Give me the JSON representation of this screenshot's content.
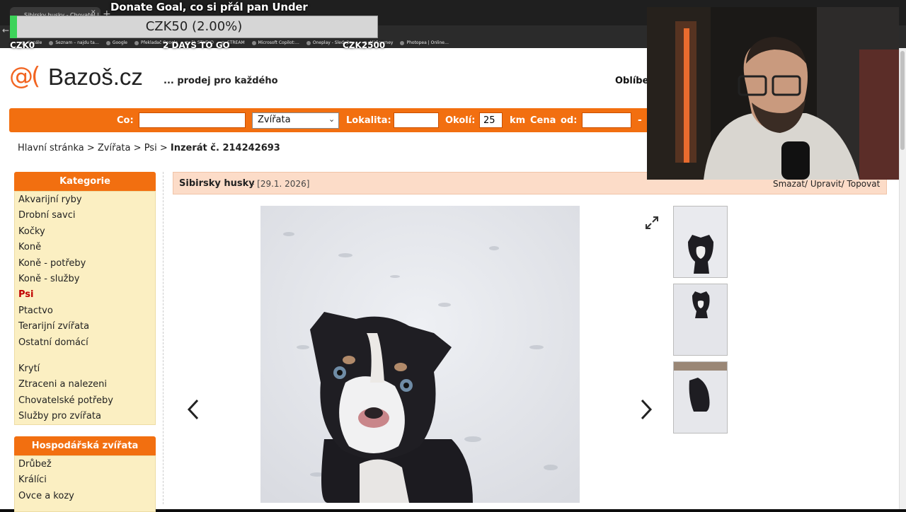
{
  "browser": {
    "active_tab": "Sibirsky husky - Chovatel | Bazoš",
    "bookmarks": [
      "Kanále",
      "Seznam – najdu ta…",
      "Google",
      "Překladač Google",
      "FL STUDIO",
      "STREAM",
      "Microsoft Copilot:…",
      "Oneplay - Sledujte…",
      "Midjourney",
      "Photopea | Online…"
    ]
  },
  "overlay": {
    "title": "Donate Goal, co si přál pan Under",
    "goal_text": "CZK50 (2.00%)",
    "goal_progress": 0.02,
    "goal_min": "CZK0",
    "goal_days": "2 DAYS TO GO",
    "goal_max": "CZK2500"
  },
  "site": {
    "logo_sign": "@(",
    "logo_name": "Bazoš.cz",
    "slogan": "... prodej pro každého",
    "favorites": "Oblíben",
    "search": {
      "co_label": "Co:",
      "co_value": "",
      "category_value": "Zvířata",
      "lokalita_label": "Lokalita:",
      "lokalita_value": "",
      "okoli_label": "Okolí:",
      "okoli_value": "25",
      "km_label": "km",
      "cena_label": "Cena",
      "od_label": "od:",
      "od_value": "",
      "dash": "-"
    },
    "breadcrumb": {
      "home": "Hlavní stránka",
      "sep": ">",
      "zvirata": "Zvířata",
      "psi": "Psi",
      "current": "Inzerát č. 214242693"
    },
    "sidebar": {
      "kategorie_title": "Kategorie",
      "kategorie_items": [
        "Akvarijní ryby",
        "Drobní savci",
        "Kočky",
        "Koně",
        "Koně - potřeby",
        "Koně - služby",
        "Psi",
        "Ptactvo",
        "Terarijní zvířata",
        "Ostatní domácí",
        "Krytí",
        "Ztraceni a nalezeni",
        "Chovatelské potřeby",
        "Služby pro zvířata"
      ],
      "active_item": "Psi",
      "hospodarska_title": "Hospodářská zvířata",
      "hospodarska_items": [
        "Drůbež",
        "Králíci",
        "Ovce a kozy"
      ]
    },
    "ad": {
      "title": "Sibirsky husky",
      "date": "- [29.1. 2026]",
      "actions": "Smazat/ Upravit/ Topovat"
    }
  },
  "icons": {
    "prev": "chevron-left-icon",
    "next": "chevron-right-icon",
    "expand": "expand-icon"
  },
  "colors": {
    "accent": "#f26f10",
    "sidebar_bg": "#fbefc2",
    "ad_header_bg": "#fcdcc8",
    "active_category": "#c00000",
    "goal_fill": "#3dd35a"
  }
}
